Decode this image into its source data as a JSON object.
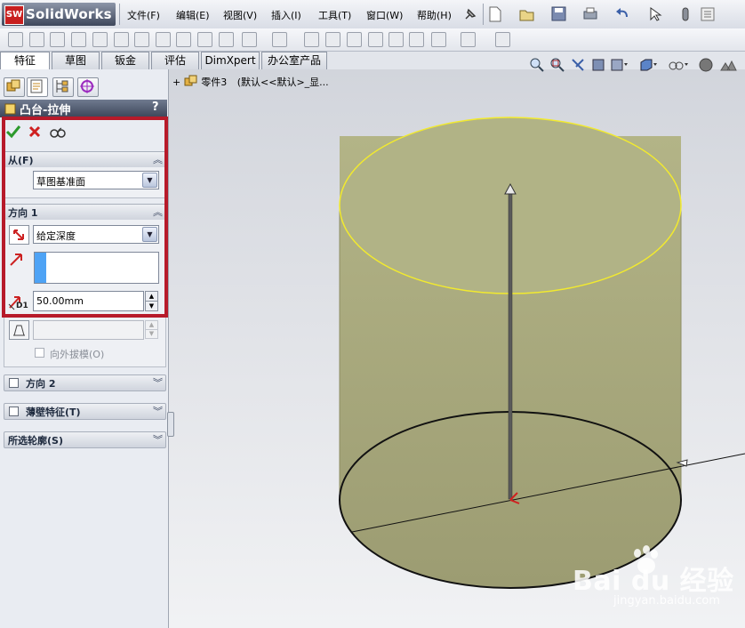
{
  "app": {
    "logo_badge": "SW",
    "name": "SolidWorks"
  },
  "menu": [
    "文件(F)",
    "编辑(E)",
    "视图(V)",
    "插入(I)",
    "工具(T)",
    "窗口(W)",
    "帮助(H)"
  ],
  "command_tabs": [
    "特征",
    "草图",
    "钣金",
    "评估",
    "DimXpert",
    "办公室产品"
  ],
  "active_tab": "特征",
  "feature_tree": {
    "part": "零件3",
    "config": "(默认<<默认>_显..."
  },
  "property_manager": {
    "title": "凸台-拉伸",
    "help": "?",
    "from": {
      "label": "从(F)",
      "value": "草图基准面"
    },
    "direction1": {
      "label": "方向 1",
      "end_condition": "给定深度",
      "depth": "50.00mm",
      "depth_icon_label": "D1",
      "draft_outward": "向外拔模(O)"
    },
    "direction2": {
      "label": "方向 2"
    },
    "thin_feature": {
      "label": "薄壁特征(T)"
    },
    "selected_contours": {
      "label": "所选轮廓(S)"
    }
  },
  "watermark": {
    "brand": "Bai du 经验",
    "url": "jingyan.baidu.com"
  },
  "colors": {
    "cylinder_fill": "#a6a67a",
    "cylinder_top": "#b1b386",
    "top_edge": "#f2ea2e",
    "highlight_box": "#b71a2a",
    "pm_header": "#4a5468"
  }
}
